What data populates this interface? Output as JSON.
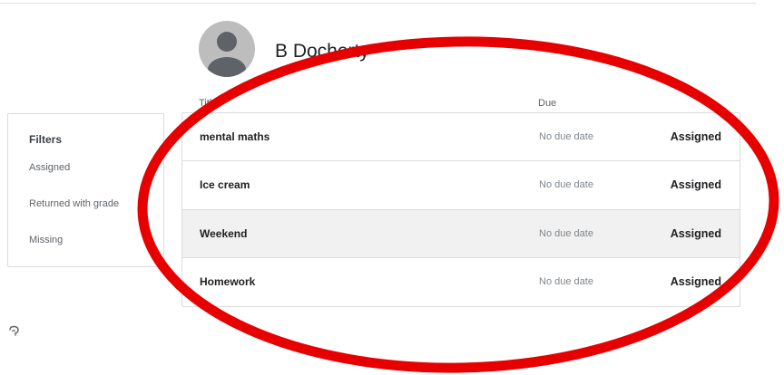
{
  "student": {
    "name": "B Docherty"
  },
  "columns": {
    "title": "Title",
    "due": "Due"
  },
  "filters": {
    "heading": "Filters",
    "items": [
      "Assigned",
      "Returned with grade",
      "Missing"
    ]
  },
  "assignments": [
    {
      "title": "mental maths",
      "due": "No due date",
      "status": "Assigned"
    },
    {
      "title": "Ice cream",
      "due": "No due date",
      "status": "Assigned"
    },
    {
      "title": "Weekend",
      "due": "No due date",
      "status": "Assigned",
      "hovered": true
    },
    {
      "title": "Homework",
      "due": "No due date",
      "status": "Assigned"
    }
  ],
  "icons": {
    "avatar": "person-icon",
    "help": "help-icon"
  },
  "colors": {
    "annotation": "#e60000",
    "divider": "#dadce0",
    "hover_row": "#f1f1f1"
  }
}
